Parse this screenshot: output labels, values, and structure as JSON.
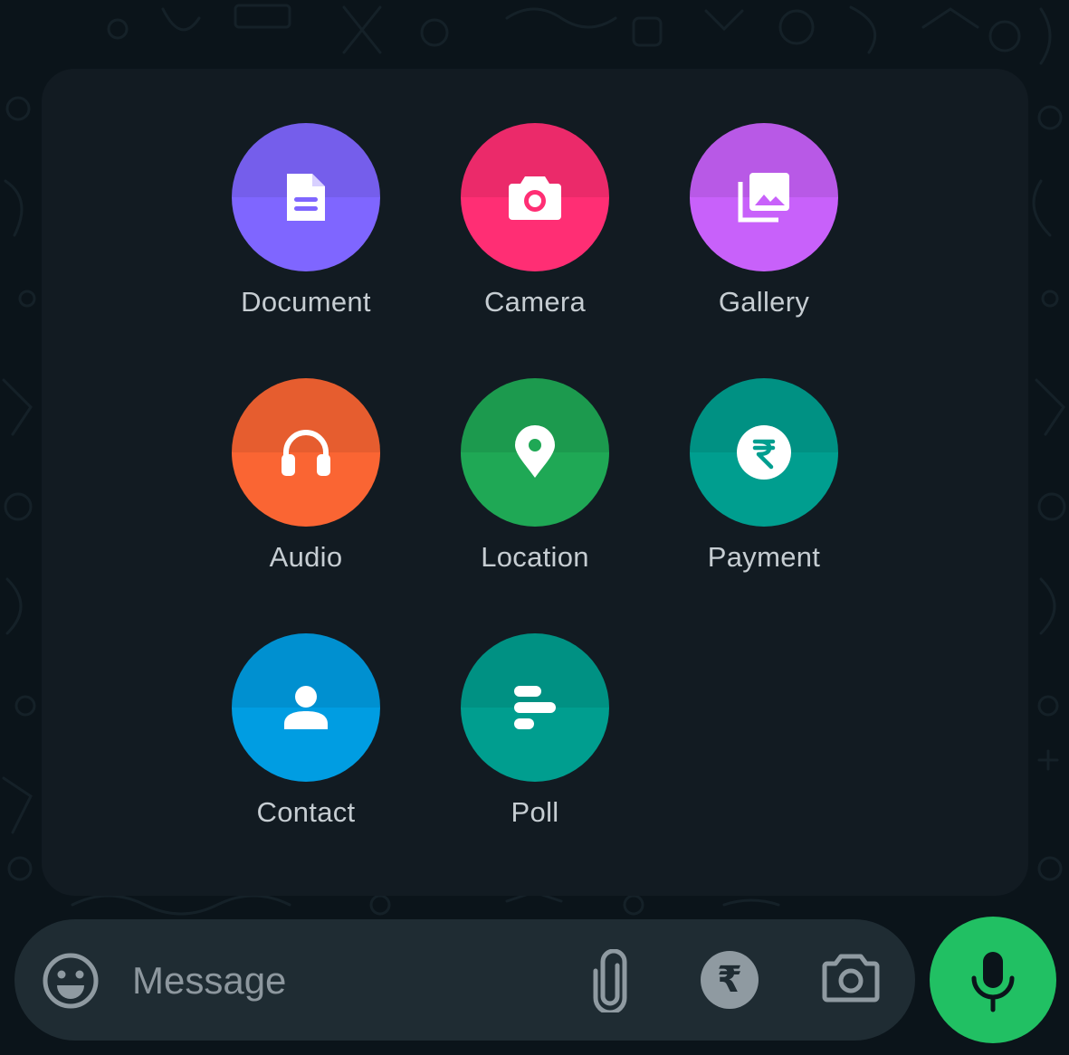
{
  "attachment_menu": {
    "options": [
      {
        "label": "Document",
        "icon": "document-icon",
        "color": "#7f66ff"
      },
      {
        "label": "Camera",
        "icon": "camera-icon",
        "color": "#ff2e74"
      },
      {
        "label": "Gallery",
        "icon": "gallery-icon",
        "color": "#c861fa"
      },
      {
        "label": "Audio",
        "icon": "headphones-icon",
        "color": "#fa6533"
      },
      {
        "label": "Location",
        "icon": "location-pin-icon",
        "color": "#1fa855"
      },
      {
        "label": "Payment",
        "icon": "rupee-icon",
        "color": "#009e8f"
      },
      {
        "label": "Contact",
        "icon": "person-icon",
        "color": "#009de2"
      },
      {
        "label": "Poll",
        "icon": "poll-icon",
        "color": "#009e8f"
      }
    ]
  },
  "composer": {
    "placeholder": "Message",
    "rupee_symbol": "₹",
    "icons": [
      "emoji-icon",
      "paperclip-icon",
      "rupee-icon",
      "camera-icon",
      "microphone-icon"
    ],
    "mic_color": "#21c063"
  },
  "theme": {
    "background": "#0b141a",
    "panel": "#121b22",
    "composer": "#1f2c33",
    "label_text": "#c6cdd2"
  }
}
